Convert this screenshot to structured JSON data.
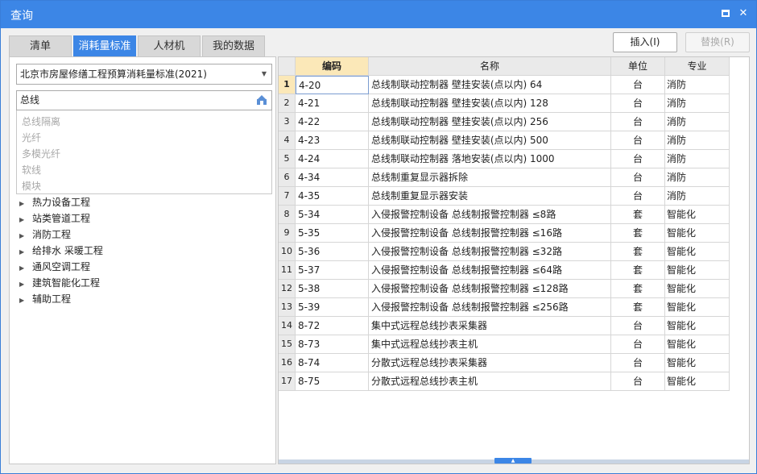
{
  "window": {
    "title": "查询"
  },
  "tabs": [
    "清单",
    "消耗量标准",
    "人材机",
    "我的数据"
  ],
  "toolbar": {
    "insert_label": "插入(I)",
    "replace_label": "替换(R)"
  },
  "left": {
    "standard_select": "北京市房屋修缮工程预算消耗量标准(2021)",
    "search_value": "总线",
    "suggestions": [
      "总线隔离",
      "光纤",
      "多模光纤",
      "软线",
      "模块"
    ],
    "tree": [
      "热力设备工程",
      "站类管道工程",
      "消防工程",
      "给排水 采暖工程",
      "通风空调工程",
      "建筑智能化工程",
      "辅助工程"
    ]
  },
  "grid": {
    "headers": [
      "编码",
      "名称",
      "单位",
      "专业"
    ],
    "rows": [
      {
        "n": "1",
        "code": "4-20",
        "name": "总线制联动控制器 壁挂安装(点以内) 64",
        "unit": "台",
        "spec": "消防"
      },
      {
        "n": "2",
        "code": "4-21",
        "name": "总线制联动控制器 壁挂安装(点以内) 128",
        "unit": "台",
        "spec": "消防"
      },
      {
        "n": "3",
        "code": "4-22",
        "name": "总线制联动控制器 壁挂安装(点以内) 256",
        "unit": "台",
        "spec": "消防"
      },
      {
        "n": "4",
        "code": "4-23",
        "name": "总线制联动控制器 壁挂安装(点以内) 500",
        "unit": "台",
        "spec": "消防"
      },
      {
        "n": "5",
        "code": "4-24",
        "name": "总线制联动控制器 落地安装(点以内) 1000",
        "unit": "台",
        "spec": "消防"
      },
      {
        "n": "6",
        "code": "4-34",
        "name": "总线制重复显示器拆除",
        "unit": "台",
        "spec": "消防"
      },
      {
        "n": "7",
        "code": "4-35",
        "name": "总线制重复显示器安装",
        "unit": "台",
        "spec": "消防"
      },
      {
        "n": "8",
        "code": "5-34",
        "name": "入侵报警控制设备 总线制报警控制器 ≤8路",
        "unit": "套",
        "spec": "智能化"
      },
      {
        "n": "9",
        "code": "5-35",
        "name": "入侵报警控制设备 总线制报警控制器 ≤16路",
        "unit": "套",
        "spec": "智能化"
      },
      {
        "n": "10",
        "code": "5-36",
        "name": "入侵报警控制设备 总线制报警控制器 ≤32路",
        "unit": "套",
        "spec": "智能化"
      },
      {
        "n": "11",
        "code": "5-37",
        "name": "入侵报警控制设备 总线制报警控制器 ≤64路",
        "unit": "套",
        "spec": "智能化"
      },
      {
        "n": "12",
        "code": "5-38",
        "name": "入侵报警控制设备 总线制报警控制器 ≤128路",
        "unit": "套",
        "spec": "智能化"
      },
      {
        "n": "13",
        "code": "5-39",
        "name": "入侵报警控制设备 总线制报警控制器 ≤256路",
        "unit": "套",
        "spec": "智能化"
      },
      {
        "n": "14",
        "code": "8-72",
        "name": "集中式远程总线抄表采集器",
        "unit": "台",
        "spec": "智能化"
      },
      {
        "n": "15",
        "code": "8-73",
        "name": "集中式远程总线抄表主机",
        "unit": "台",
        "spec": "智能化"
      },
      {
        "n": "16",
        "code": "8-74",
        "name": "分散式远程总线抄表采集器",
        "unit": "台",
        "spec": "智能化"
      },
      {
        "n": "17",
        "code": "8-75",
        "name": "分散式远程总线抄表主机",
        "unit": "台",
        "spec": "智能化"
      }
    ]
  },
  "colors": {
    "accent": "#3c86e6",
    "header_selected": "#fbe8b8"
  }
}
